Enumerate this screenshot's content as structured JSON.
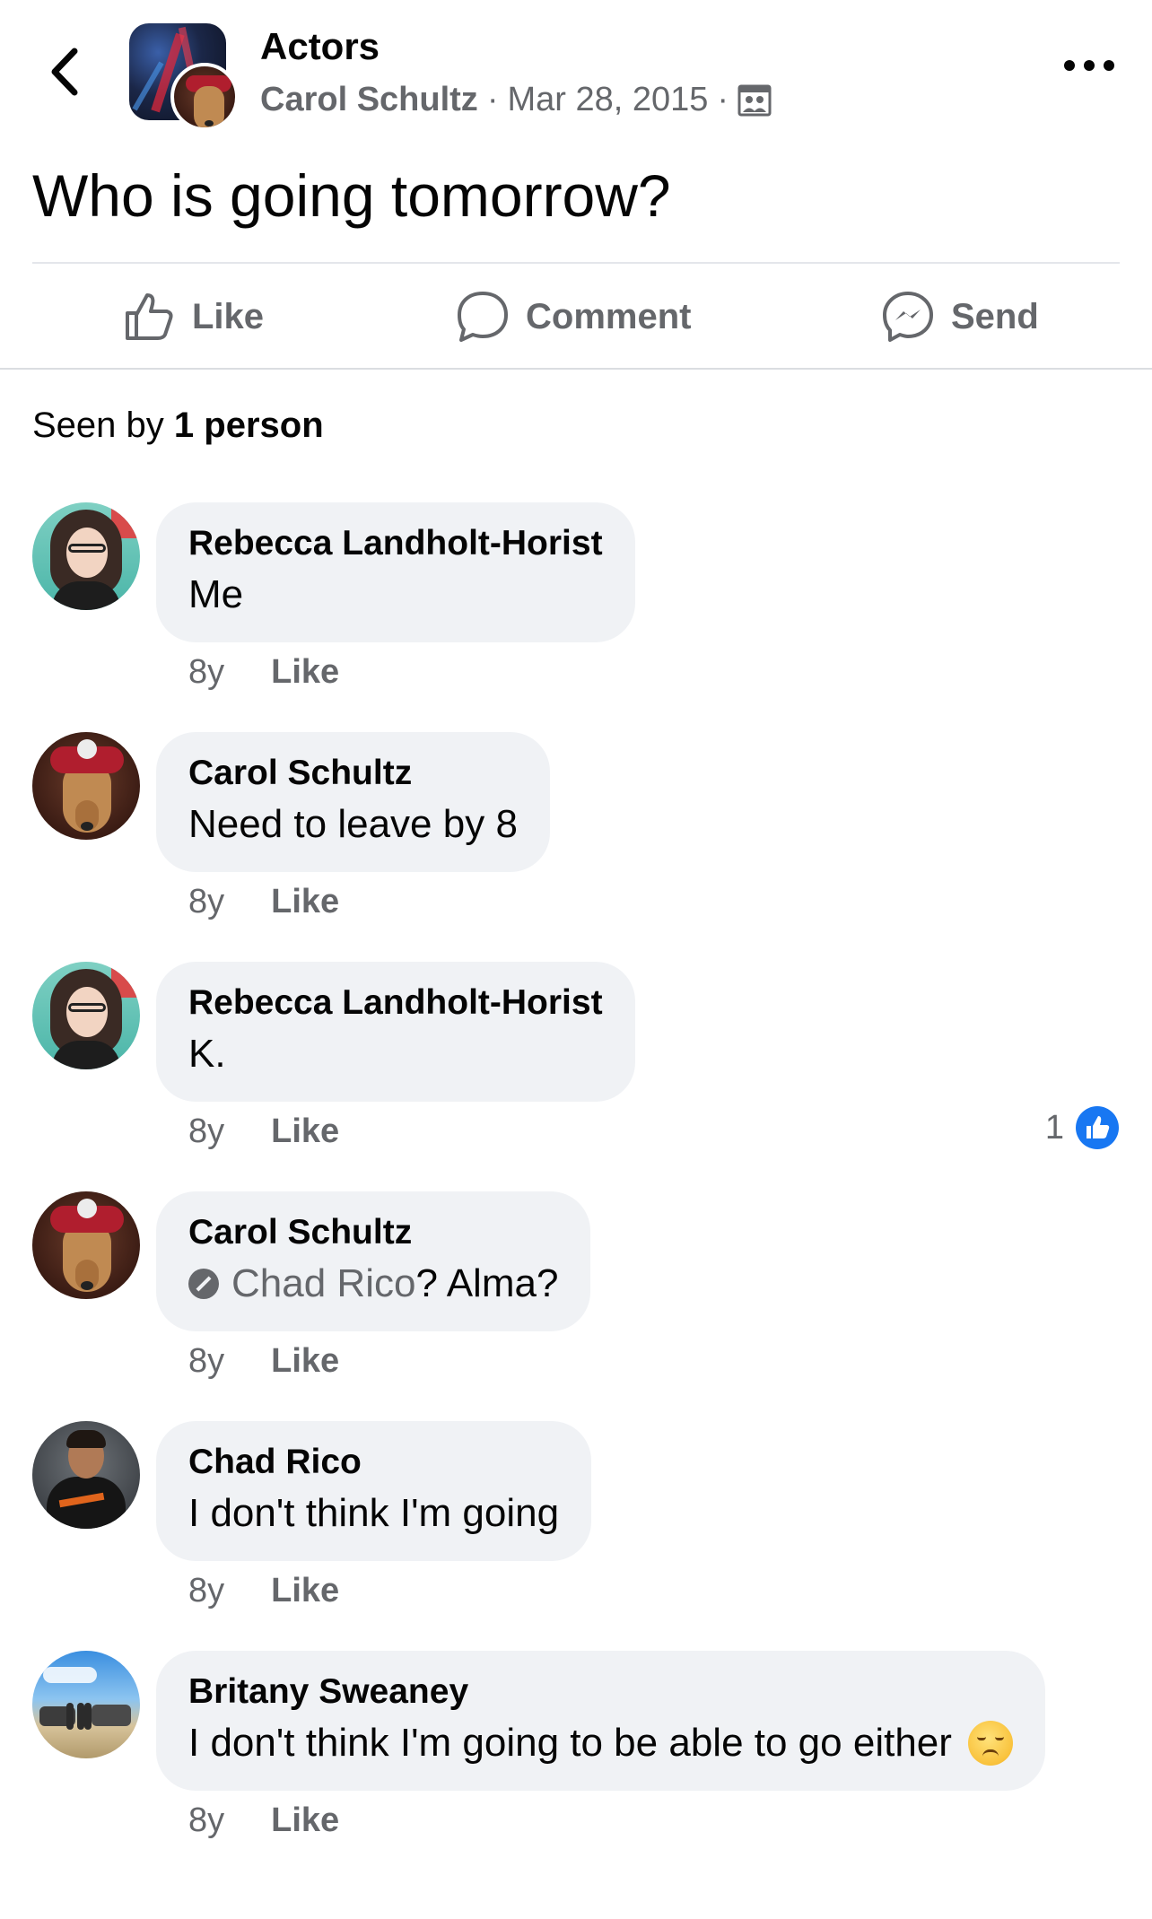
{
  "header": {
    "group_name": "Actors",
    "author": "Carol Schultz",
    "date": "Mar 28, 2015",
    "separator": "·"
  },
  "post": {
    "text": "Who is going tomorrow?"
  },
  "actions": {
    "like_label": "Like",
    "comment_label": "Comment",
    "send_label": "Send"
  },
  "seen": {
    "prefix": "Seen by",
    "count": "1 person"
  },
  "comments": [
    {
      "name": "Rebecca Landholt-Horist",
      "text": "Me",
      "age": "8y",
      "like_label": "Like"
    },
    {
      "name": "Carol Schultz",
      "text": "Need to leave by 8",
      "age": "8y",
      "like_label": "Like"
    },
    {
      "name": "Rebecca Landholt-Horist",
      "text": "K.",
      "age": "8y",
      "like_label": "Like",
      "reaction_count": "1"
    },
    {
      "name": "Carol Schultz",
      "mention": "Chad Rico",
      "text": "? Alma?",
      "age": "8y",
      "like_label": "Like"
    },
    {
      "name": "Chad Rico",
      "text": "I don't think I'm going",
      "age": "8y",
      "like_label": "Like"
    },
    {
      "name": "Britany Sweaney",
      "text": "I don't think I'm going to be able to go either",
      "age": "8y",
      "like_label": "Like",
      "emoji": "disappointed-face"
    }
  ],
  "colors": {
    "bubble": "#f0f2f5",
    "secondary_text": "#65676b",
    "like_blue": "#1877f2"
  }
}
